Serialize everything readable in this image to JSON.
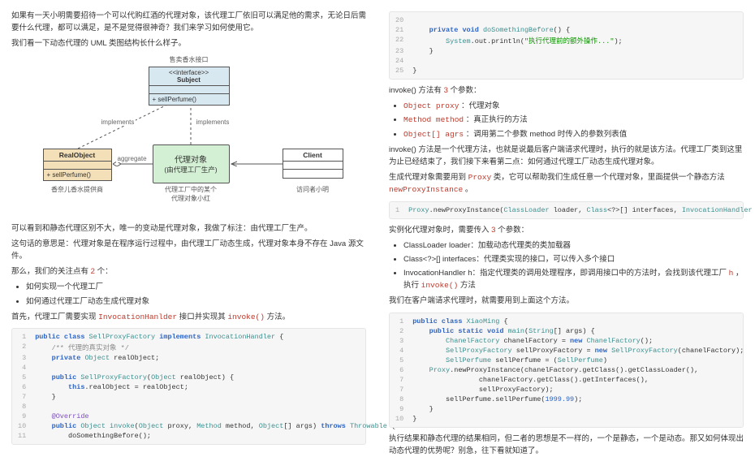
{
  "left": {
    "intro1": "如果有一天小明需要招待一个可以代购红酒的代理对象，该代理工厂依旧可以满足他的需求，无论日后需要什么代理，都可以满足，是不是觉得很神奇？我们来学习如何使用它。",
    "intro2": "我们看一下动态代理的 UML 类图结构长什么样子。",
    "uml": {
      "subject_title": "售卖香水接口",
      "subject_iface": "<<interface>>",
      "subject_name": "Subject",
      "subject_method": "+ sellPerfume()",
      "real_name": "RealObject",
      "real_method": "+ sellPerfume()",
      "real_caption": "香奈儿香水提供商",
      "proxy_l1": "代理对象",
      "proxy_l2": "(由代理工厂生产)",
      "proxy_caption1": "代理工厂中的某个",
      "proxy_caption2": "代理对象小红",
      "client_name": "Client",
      "client_caption": "访问者小明",
      "lbl_impl_left": "implements",
      "lbl_impl_right": "implements",
      "lbl_aggr": "aggregate"
    },
    "para_after_uml": "可以看到和静态代理区别不大，唯一的变动是代理对象，我做了标注：由代理工厂生产。",
    "para_meaning": "这句话的意思是：代理对象是在程序运行过程中，由代理工厂动态生成，代理对象本身不存在 Java 源文件。",
    "para_focus_pre": "那么，我们的关注点有",
    "para_focus_n": " 2 ",
    "para_focus_post": "个：",
    "focus_items": {
      "a": "如何实现一个代理工厂",
      "b": "如何通过代理工厂动态生成代理对象"
    },
    "para_invoc_pre": "首先，代理工厂需要实现 ",
    "para_invoc_cls": "InvocationHanlder",
    "para_invoc_mid": " 接口并实现其 ",
    "para_invoc_m": "invoke()",
    "para_invoc_post": " 方法。",
    "code1": {
      "lines": [
        {
          "n": "1",
          "h": "<span class='kw-blue'>public</span> <span class='kw-blue'>class</span> <span class='kw-teal'>SellProxyFactory</span> <span class='kw-blue'>implements</span> <span class='kw-teal'>InvocationHandler</span> {"
        },
        {
          "n": "2",
          "h": "    <span class='dim'>/** 代理的真实对象 */</span>"
        },
        {
          "n": "3",
          "h": "    <span class='kw-blue'>private</span> <span class='kw-teal'>Object</span> realObject;"
        },
        {
          "n": "4",
          "h": ""
        },
        {
          "n": "5",
          "h": "    <span class='kw-blue'>public</span> <span class='kw-teal'>SellProxyFactory</span>(<span class='kw-teal'>Object</span> realObject) {"
        },
        {
          "n": "6",
          "h": "        <span class='kw-blue'>this</span>.realObject = realObject;"
        },
        {
          "n": "7",
          "h": "    }"
        },
        {
          "n": "8",
          "h": ""
        },
        {
          "n": "9",
          "h": "    <span class='kw-purple'>@Override</span>"
        },
        {
          "n": "10",
          "h": "    <span class='kw-blue'>public</span> <span class='kw-teal'>Object</span> <span class='kw-teal'>invoke</span>(<span class='kw-teal'>Object</span> proxy, <span class='kw-teal'>Method</span> method, <span class='kw-teal'>Object</span>[] args) <span class='kw-blue'>throws</span> <span class='kw-teal'>Throwable</span> {"
        },
        {
          "n": "11",
          "h": "        doSomethingBefore();"
        }
      ]
    }
  },
  "right": {
    "code_top": {
      "lines": [
        {
          "n": "20",
          "h": ""
        },
        {
          "n": "21",
          "h": "    <span class='kw-blue'>private</span> <span class='kw-blue'>void</span> <span class='kw-teal'>doSomethingBefore</span>() {"
        },
        {
          "n": "22",
          "h": "        <span class='kw-teal'>System</span>.out.println(<span class='str'>\"执行代理前的额外操作...\"</span>);"
        },
        {
          "n": "23",
          "h": "    }"
        },
        {
          "n": "24",
          "h": ""
        },
        {
          "n": "25",
          "h": "}"
        }
      ]
    },
    "p_params_pre": "invoke() 方法有",
    "p_params_n": " 3 ",
    "p_params_post": "个参数：",
    "param_list": {
      "a_pre": "Object proxy",
      "a_post": " ：代理对象",
      "b_pre": "Method method",
      "b_post": " ：真正执行的方法",
      "c_pre": "Object[] agrs",
      "c_post": " ：调用第二个参数 method 时传入的参数列表值"
    },
    "p_invoke_expl": "invoke() 方法是一个代理方法，也就是说最后客户端请求代理时，执行的就是该方法。代理工厂类到这里为止已经结束了，我们接下来看第二点：如何通过代理工厂动态生成代理对象。",
    "p_proxy_pre": "生成代理对象需要用到 ",
    "p_proxy_cls": "Proxy",
    "p_proxy_mid": " 类，它可以帮助我们生成任意一个代理对象，里面提供一个静态方法",
    "p_proxy_m": "newProxyInstance",
    "p_proxy_post": " 。",
    "code_npi": {
      "lines": [
        {
          "n": "1",
          "h": "<span class='kw-teal'>Proxy</span>.newProxyInstance(<span class='kw-teal'>ClassLoader</span> loader, <span class='kw-teal'>Class</span>&lt;?&gt;[] interfaces, <span class='kw-teal'>InvocationHandler</span> h);"
        }
      ]
    },
    "p_inst_pre": "实例化代理对象时，需要传入",
    "p_inst_n": " 3 ",
    "p_inst_post": "个参数：",
    "inst_list": {
      "a": "ClassLoader loader：加载动态代理类的类加载器",
      "b": "Class<?>[] interfaces：代理类实现的接口，可以传入多个接口",
      "c_pre": "InvocationHandler h：指定代理类的调用处理程序，即调用接口中的方法时，会找到该代理工厂",
      "c_h": "h",
      "c_mid": "，执行",
      "c_m": "invoke()",
      "c_post": " 方法"
    },
    "p_client": "我们在客户端请求代理时，就需要用到上面这个方法。",
    "code_main": {
      "lines": [
        {
          "n": "1",
          "h": "<span class='kw-blue'>public</span> <span class='kw-blue'>class</span> <span class='kw-teal'>XiaoMing</span> {"
        },
        {
          "n": "2",
          "h": "    <span class='kw-blue'>public</span> <span class='kw-blue'>static</span> <span class='kw-blue'>void</span> <span class='kw-teal'>main</span>(<span class='kw-teal'>String</span>[] args) {"
        },
        {
          "n": "3",
          "h": "        <span class='kw-teal'>ChanelFactory</span> chanelFactory = <span class='kw-blue'>new</span> <span class='kw-teal'>ChanelFactory</span>();"
        },
        {
          "n": "4",
          "h": "        <span class='kw-teal'>SellProxyFactory</span> sellProxyFactory = <span class='kw-blue'>new</span> <span class='kw-teal'>SellProxyFactory</span>(chanelFactory);"
        },
        {
          "n": "5",
          "h": "        <span class='kw-teal'>SellPerfume</span> sellPerfume = (<span class='kw-teal'>SellPerfume</span>)"
        },
        {
          "n": "6",
          "h": "    <span class='kw-teal'>Proxy</span>.newProxyInstance(chanelFactory.getClass().getClassLoader(),"
        },
        {
          "n": "7",
          "h": "                chanelFactory.getClass().getInterfaces(),"
        },
        {
          "n": "7",
          "h": "                sellProxyFactory);"
        },
        {
          "n": "8",
          "h": "        sellPerfume.sellPerfume(<span class='num'>1999.99</span>);"
        },
        {
          "n": "9",
          "h": "    }"
        },
        {
          "n": "10",
          "h": "}"
        }
      ]
    },
    "p_end": "执行结果和静态代理的结果相同，但二者的思想是不一样的，一个是静态，一个是动态。那又如何体现出动态代理的优势呢？别急，往下看就知道了。"
  }
}
